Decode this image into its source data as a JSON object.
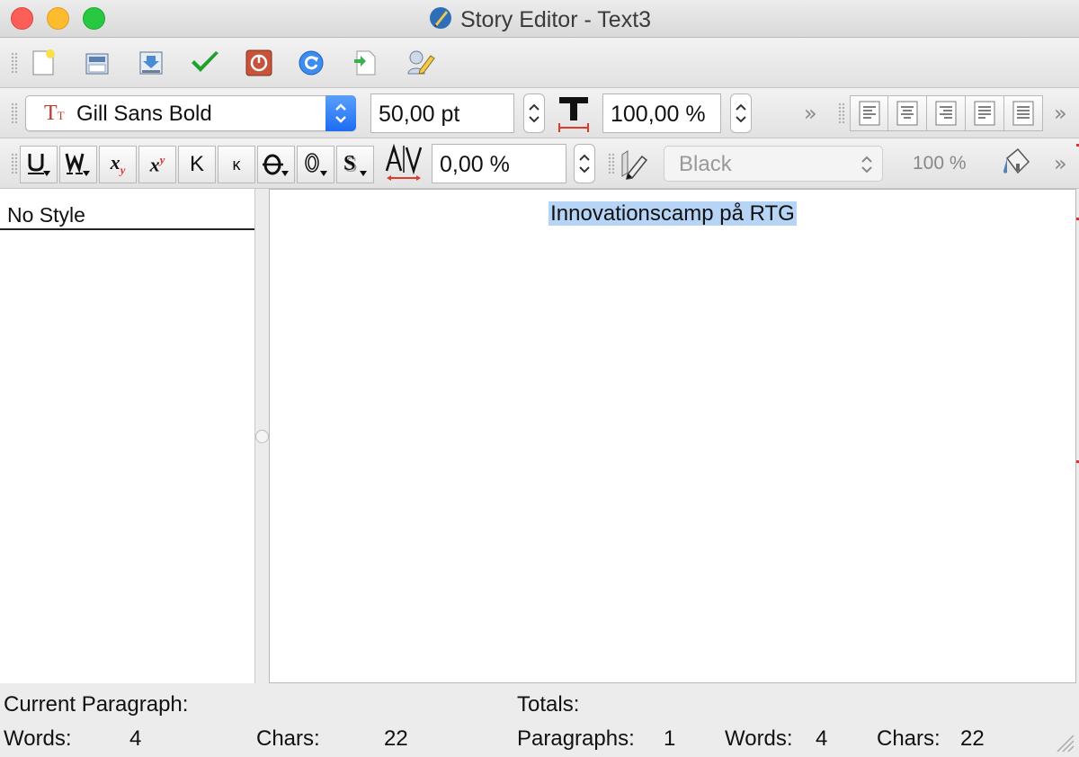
{
  "window": {
    "title": "Story Editor - Text3"
  },
  "toolbar_main": {
    "buttons": [
      "new-file-icon",
      "open-folder-icon",
      "import-icon",
      "checkmark-icon",
      "power-icon",
      "reload-icon",
      "insert-sample-icon",
      "edit-properties-icon"
    ]
  },
  "format_bar": {
    "font": "Gill Sans Bold",
    "font_size": "50,00 pt",
    "scaling": "100,00 %",
    "tracking": "0,00 %",
    "color": "Black",
    "shade": "100 %",
    "style_buttons": [
      "underline",
      "underline-words",
      "subscript",
      "superscript",
      "K",
      "κ",
      "strikethrough",
      "outline",
      "shadow"
    ]
  },
  "styles_panel": {
    "items": [
      "No Style"
    ]
  },
  "editor": {
    "text": "Innovationscamp på RTG"
  },
  "status": {
    "current_label": "Current Paragraph:",
    "totals_label": "Totals:",
    "words_label": "Words:",
    "words_value": "4",
    "chars_label": "Chars:",
    "chars_value": "22",
    "paragraphs_label": "Paragraphs:",
    "paragraphs_value": "1",
    "total_words_label": "Words:",
    "total_words_value": "4",
    "total_chars_label": "Chars:",
    "total_chars_value": "22"
  },
  "colors": {
    "selection": "#b6d4f6",
    "accent": "#1d6cf3"
  }
}
